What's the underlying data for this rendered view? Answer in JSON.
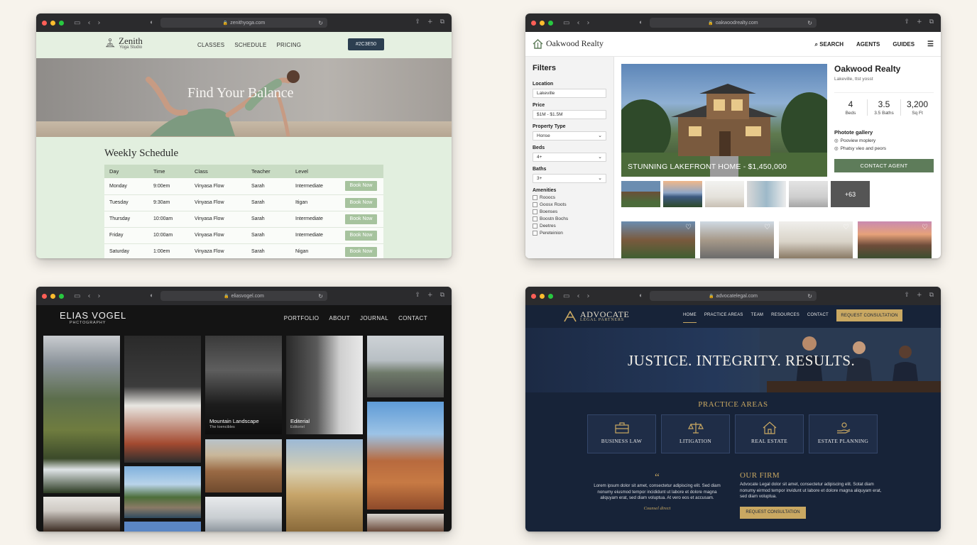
{
  "colors": {
    "background": "#f7f3ec",
    "zenith_green": "#e2efdf",
    "zenith_chip": "#2c3e50",
    "oakwood_green": "#5e7c5a",
    "advocate_navy": "#172338",
    "advocate_gold": "#c9a862"
  },
  "zenith": {
    "url": "zenithyoga.com",
    "brand": "Zenith",
    "brand_sub": "Yoga Studio",
    "nav": [
      "CLASSES",
      "SCHEDULE",
      "PRICING"
    ],
    "chip": "#2C3E50",
    "hero_title": "Find Your Balance",
    "schedule_title": "Weekly Schedule",
    "columns": [
      "Day",
      "Time",
      "Class",
      "Teacher",
      "Level"
    ],
    "book_label": "Book Now",
    "rows": [
      {
        "day": "Monday",
        "time": "9:00em",
        "class": "Vinyasa Flow",
        "teacher": "Sarah",
        "level": "Intermediate",
        "book": "Book Now"
      },
      {
        "day": "Tuesday",
        "time": "9:30am",
        "class": "Vinyasa Flow",
        "teacher": "Sarah",
        "level": "Itigan",
        "book": "Book Now"
      },
      {
        "day": "Thursday",
        "time": "10:00am",
        "class": "Vinyasa Flow",
        "teacher": "Sarah",
        "level": "Intermediate",
        "book": "Book Now"
      },
      {
        "day": "Friday",
        "time": "10:00am",
        "class": "Vinyasa Flow",
        "teacher": "Sarah",
        "level": "Intermediate",
        "book": "Book Now"
      },
      {
        "day": "Saturday",
        "time": "1:00em",
        "class": "Vinyaza Flow",
        "teacher": "Sarah",
        "level": "Nigan",
        "book": "Book Now"
      }
    ]
  },
  "oakwood": {
    "url": "oakwoodrealty.com",
    "brand": "Oakwood Realty",
    "nav": [
      "SEARCH",
      "AGENTS",
      "GUIDES"
    ],
    "filters_title": "Filters",
    "filters": [
      {
        "label": "Location",
        "value": "Lakeville",
        "dropdown": false
      },
      {
        "label": "Price",
        "value": "$1M - $1.5M",
        "dropdown": false
      },
      {
        "label": "Property Type",
        "value": "Honse",
        "dropdown": true
      },
      {
        "label": "Beds",
        "value": "4+",
        "dropdown": true
      },
      {
        "label": "Baths",
        "value": "3+",
        "dropdown": true
      }
    ],
    "amenities_label": "Amenities",
    "amenities": [
      "Rooocs",
      "Goosx Roots",
      "Boenses",
      "Boostn Bochs",
      "Deetres",
      "Pereteinion"
    ],
    "main_caption": "STUNNING LAKEFRONT HOME - $1,450,000",
    "more_photos": "+63",
    "listing_title": "Oakwood Realty",
    "listing_location": "Lakeville, ttst yosst",
    "stats": [
      {
        "value": "4",
        "label": "Beds"
      },
      {
        "value": "3.5",
        "label": "3.5 Baths"
      },
      {
        "value": "3,200",
        "label": "Sq Ft"
      }
    ],
    "gallery_title": "Photote gallery",
    "gallery_items": [
      "Pooview moplery",
      "Phatsy vieo and peors"
    ],
    "contact_button": "CONTACT AGENT"
  },
  "elias": {
    "url": "eliasvogel.com",
    "brand": "ELIAS VOGEL",
    "brand_sub": "PHCTOGRAPHY",
    "nav": [
      "PORTFOLIO",
      "ABOUT",
      "JOURNAL",
      "CONTACT"
    ],
    "captions": [
      {
        "title": "Mountain Landscape",
        "sub": "The toencibles"
      },
      {
        "title": "Editerial",
        "sub": "Editoriel"
      }
    ]
  },
  "advocate": {
    "url": "advocatelegal.com",
    "brand": "ADVOCATE",
    "brand_sub": "LEGAL PARTNERS",
    "nav": [
      "HOME",
      "PRACTICE AREAS",
      "TEAM",
      "RESOURCES",
      "CONTACT"
    ],
    "cta": "REQUEST CONSULTATION",
    "hero_title": "JUSTICE. INTEGRITY. RESULTS.",
    "practice_title": "PRACTICE AREAS",
    "practice_areas": [
      {
        "label": "BUSINESS LAW",
        "icon": "briefcase-icon"
      },
      {
        "label": "LITIGATION",
        "icon": "scales-icon"
      },
      {
        "label": "REAL ESTATE",
        "icon": "house-icon"
      },
      {
        "label": "ESTATE PLANNING",
        "icon": "hand-person-icon"
      }
    ],
    "quote_text": "Lorem ipsum dolor sit amet, consectetur adipiscing elit. Sed diam nonumy eiusmod tempor incididunt ut labore et dolore magna aliquyam erat, sed diam voluptua. At vero eos et accusam.",
    "quote_sig": "Counsel direct",
    "firm_title": "OUR FIRM",
    "firm_text": "Advocate Legal dolor sit amet, consectetur adipiscing elit. Sotat diam nonumy eirmod tempor invidunt ut labore et dolore magna aliquyam erat, sed diam voluptua.",
    "firm_button": "REQUEST CONSULTATION"
  }
}
